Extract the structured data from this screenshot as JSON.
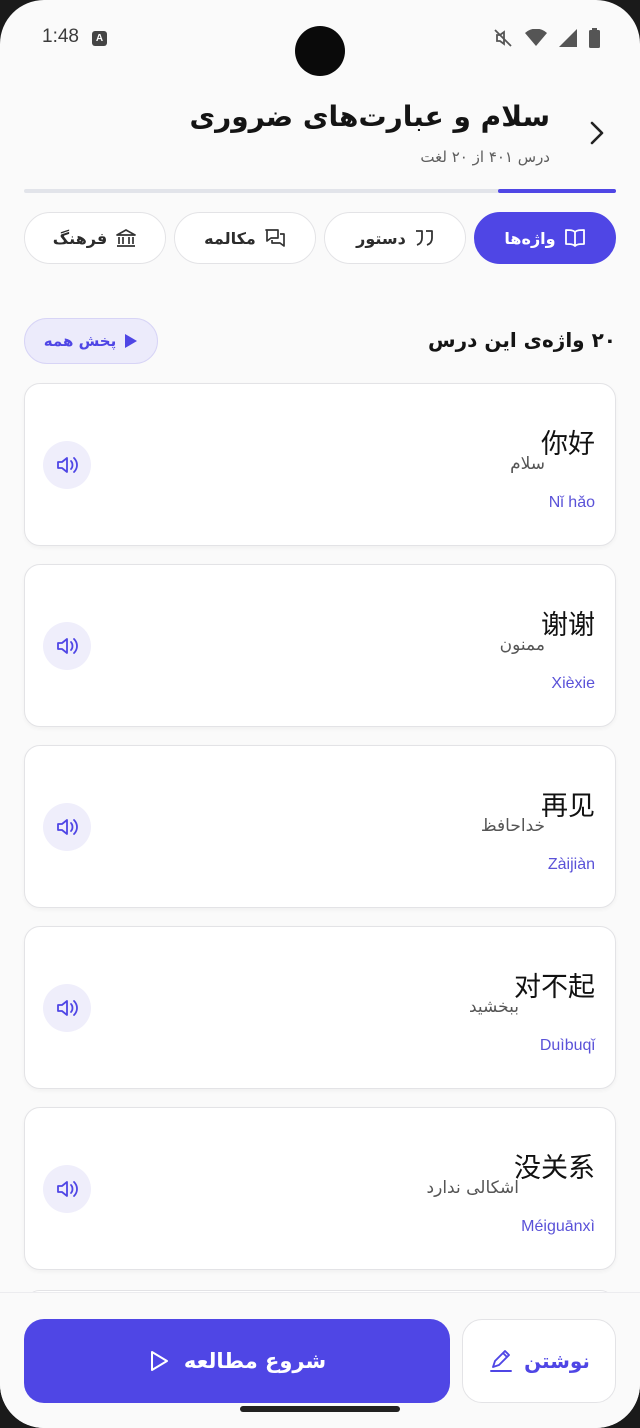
{
  "status_bar": {
    "time": "1:48",
    "notification_badge": "A",
    "icons": [
      "mute-icon",
      "wifi-icon",
      "signal-icon",
      "battery-icon"
    ]
  },
  "header": {
    "title": "سلام و عبارت‌های ضروری",
    "subtitle": "درس ۴۰۱ از ۲۰ لغت",
    "progress_fraction": 0.2
  },
  "tabs": [
    {
      "label": "واژه‌ها",
      "icon": "book-icon",
      "active": true
    },
    {
      "label": "دستور",
      "icon": "quote-icon",
      "active": false
    },
    {
      "label": "مکالمه",
      "icon": "chat-icon",
      "active": false
    },
    {
      "label": "فرهنگ",
      "icon": "bank-icon",
      "active": false
    }
  ],
  "section": {
    "title": "۲۰ واژه‌ی این درس",
    "play_all_label": "پخش همه"
  },
  "words": [
    {
      "hanzi": "你好",
      "meaning": "سلام",
      "pinyin": "Nǐ hǎo"
    },
    {
      "hanzi": "谢谢",
      "meaning": "ممنون",
      "pinyin": "Xièxie"
    },
    {
      "hanzi": "再见",
      "meaning": "خداحافظ",
      "pinyin": "Zàijiàn"
    },
    {
      "hanzi": "对不起",
      "meaning": "ببخشید",
      "pinyin": "Duìbuqǐ"
    },
    {
      "hanzi": "没关系",
      "meaning": "اشکالی ندارد",
      "pinyin": "Méiguānxì"
    }
  ],
  "bottom": {
    "write_label": "نوشتن",
    "study_label": "شروع مطالعه"
  },
  "colors": {
    "accent": "#4f46e5",
    "accent_soft": "#ecebfb",
    "background": "#fafafa"
  }
}
